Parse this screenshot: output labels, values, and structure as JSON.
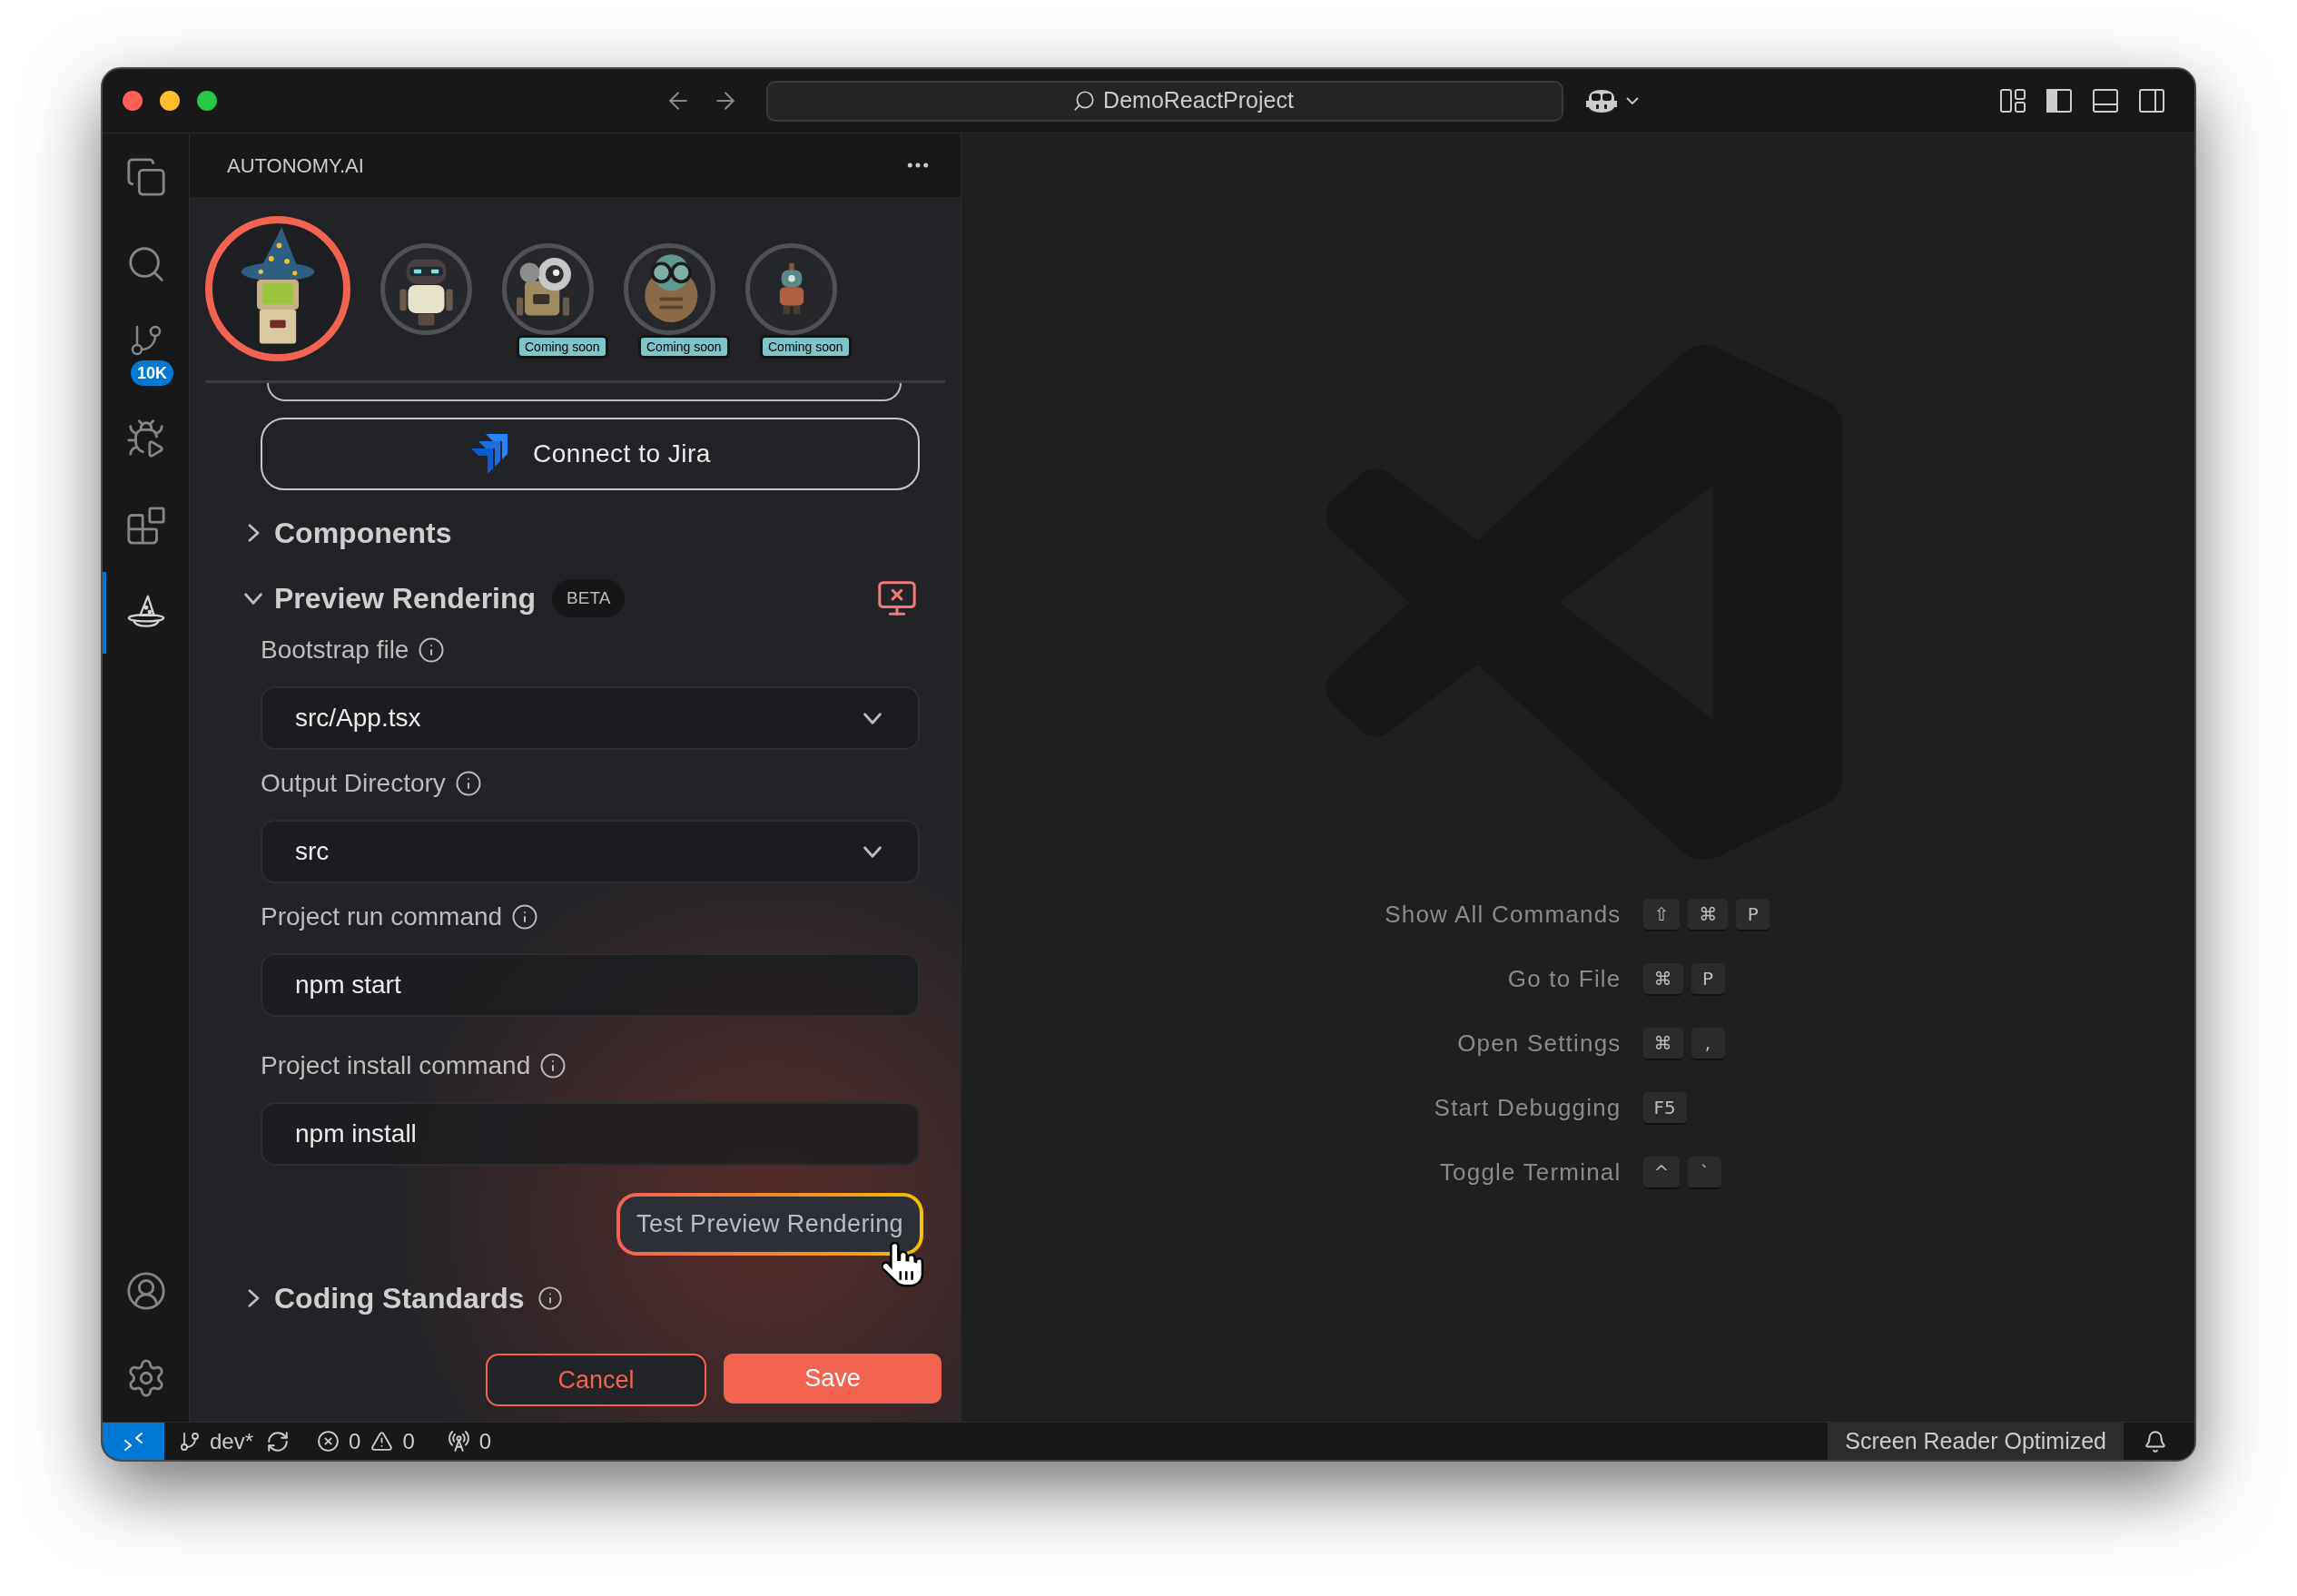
{
  "window": {
    "title": "DemoReactProject"
  },
  "activity_bar": {
    "items": [
      {
        "kind": "files",
        "selected": false
      },
      {
        "kind": "search",
        "selected": false
      },
      {
        "kind": "source_control",
        "selected": false,
        "badge": "10K"
      },
      {
        "kind": "run_debug",
        "selected": false
      },
      {
        "kind": "extensions",
        "selected": false
      },
      {
        "kind": "autonomy",
        "selected": true
      }
    ],
    "bottom_items": [
      {
        "kind": "account"
      },
      {
        "kind": "settings"
      }
    ]
  },
  "side_panel": {
    "title": "AUTONOMY.AI",
    "agents": [
      {
        "selected": true
      },
      {
        "selected": false
      },
      {
        "selected": false,
        "badge": "Coming soon"
      },
      {
        "selected": false,
        "badge": "Coming soon"
      },
      {
        "selected": false,
        "badge": "Coming soon"
      }
    ],
    "connect_button": "Connect to Jira",
    "sections": [
      {
        "title": "Components",
        "expanded": false,
        "info": false
      },
      {
        "title": "Preview Rendering",
        "expanded": true,
        "info": false,
        "badge": "BETA",
        "preview_running": false,
        "fields": [
          {
            "label": "Bootstrap file",
            "kind": "select",
            "value": "src/App.tsx"
          },
          {
            "label": "Output Directory",
            "kind": "select",
            "value": "src"
          },
          {
            "label": "Project run command",
            "kind": "input",
            "value": "npm start"
          },
          {
            "label": "Project install command",
            "kind": "input",
            "value": "npm install"
          }
        ],
        "test_button": "Test Preview Rendering"
      },
      {
        "title": "Coding Standards",
        "expanded": false,
        "info": true
      }
    ],
    "actions": [
      {
        "label": "Cancel",
        "kind": "secondary"
      },
      {
        "label": "Save",
        "kind": "primary"
      }
    ]
  },
  "editor": {
    "shortcuts": [
      {
        "label": "Show All Commands",
        "keys": [
          "⇧",
          "⌘",
          "P"
        ]
      },
      {
        "label": "Go to File",
        "keys": [
          "⌘",
          "P"
        ]
      },
      {
        "label": "Open Settings",
        "keys": [
          "⌘",
          ","
        ]
      },
      {
        "label": "Start Debugging",
        "keys": [
          "F5"
        ]
      },
      {
        "label": "Toggle Terminal",
        "keys": [
          "^",
          "`"
        ]
      }
    ]
  },
  "status_bar": {
    "branch": "dev*",
    "errors": "0",
    "warnings": "0",
    "ports": "0",
    "mode": "Screen Reader Optimized"
  }
}
